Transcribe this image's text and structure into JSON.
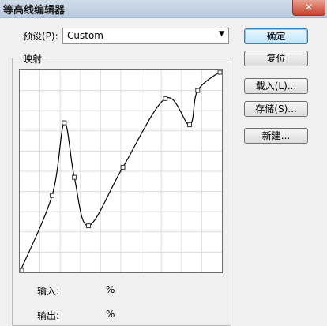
{
  "window": {
    "title": "等高线编辑器",
    "close_glyph": "✕"
  },
  "preset": {
    "label": "预设(P):",
    "value": "Custom",
    "arrow_glyph": "▼"
  },
  "mapping": {
    "group_label": "映射",
    "input_label": "输入:",
    "output_label": "输出:",
    "unit": "%"
  },
  "buttons": {
    "ok": "确定",
    "reset": "复位",
    "load": "载入(L)...",
    "save": "存储(S)...",
    "new": "新建..."
  },
  "curve": {
    "grid_divisions": 10,
    "points": [
      [
        0,
        0
      ],
      [
        16,
        38
      ],
      [
        22,
        74
      ],
      [
        27,
        47
      ],
      [
        34,
        23
      ],
      [
        51,
        52
      ],
      [
        72,
        86
      ],
      [
        84,
        73
      ],
      [
        88,
        90
      ],
      [
        100,
        100
      ]
    ]
  }
}
